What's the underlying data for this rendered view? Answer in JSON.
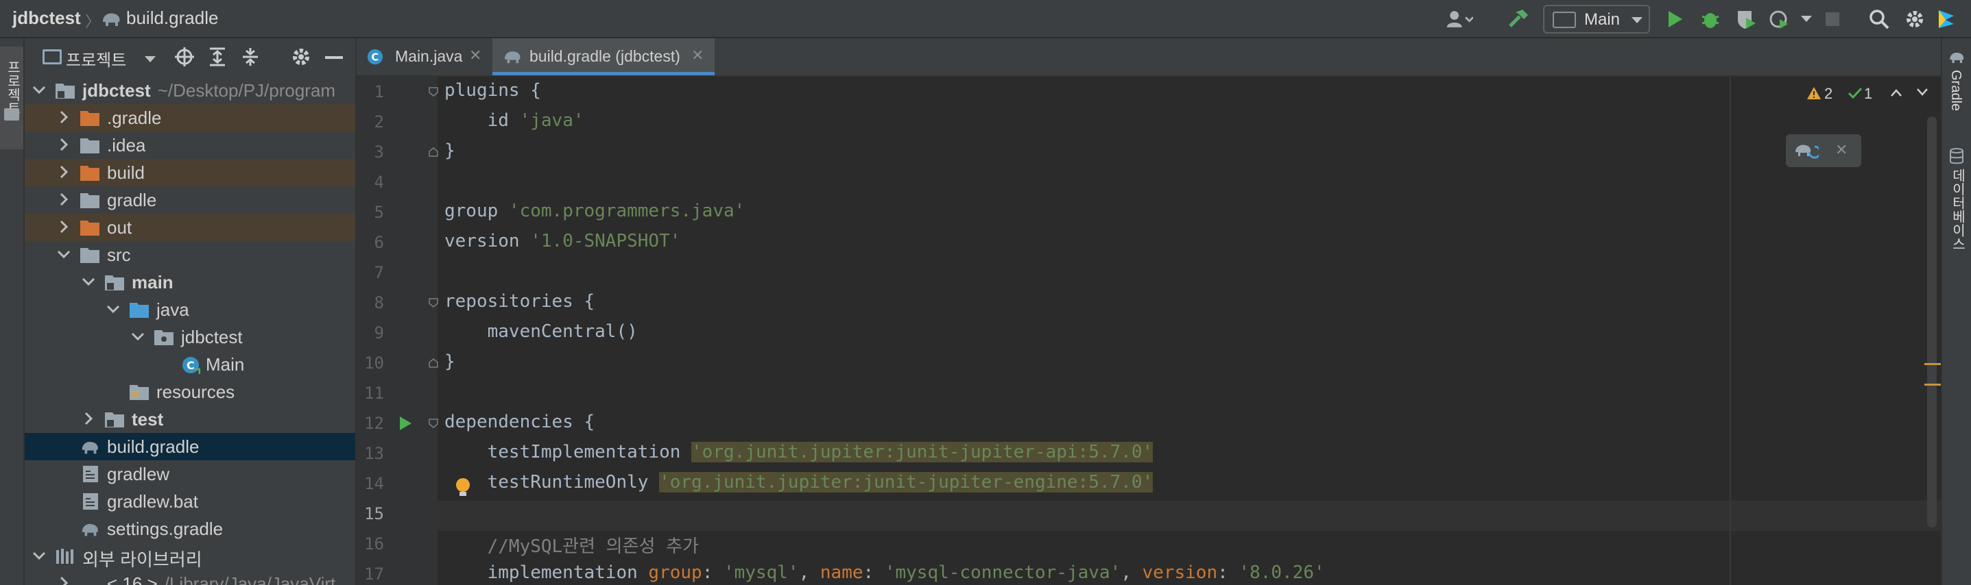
{
  "navbar": {
    "project": "jdbctest",
    "file": "build.gradle",
    "run_config": "Main"
  },
  "left_stripe": {
    "project_tab": "프로젝트"
  },
  "project_panel": {
    "title": "프로젝트",
    "tree": [
      {
        "label": "jdbctest",
        "hint": "~/Desktop/PJ/program",
        "bold": true
      },
      {
        "label": ".gradle"
      },
      {
        "label": ".idea"
      },
      {
        "label": "build"
      },
      {
        "label": "gradle"
      },
      {
        "label": "out"
      },
      {
        "label": "src"
      },
      {
        "label": "main",
        "bold": true
      },
      {
        "label": "java"
      },
      {
        "label": "jdbctest"
      },
      {
        "label": "Main"
      },
      {
        "label": "resources"
      },
      {
        "label": "test",
        "bold": true
      },
      {
        "label": "build.gradle"
      },
      {
        "label": "gradlew"
      },
      {
        "label": "gradlew.bat"
      },
      {
        "label": "settings.gradle"
      },
      {
        "label": "외부 라이브러리"
      },
      {
        "label": "< 16 >",
        "hint": "/Library/Java/JavaVirt"
      }
    ]
  },
  "tabs": [
    {
      "label": "Main.java"
    },
    {
      "label": "build.gradle (jdbctest)"
    }
  ],
  "editor": {
    "warnings": "2",
    "ok": "1",
    "line_numbers": [
      "1",
      "2",
      "3",
      "4",
      "5",
      "6",
      "7",
      "8",
      "9",
      "10",
      "11",
      "12",
      "13",
      "14",
      "15",
      "16",
      "17"
    ],
    "lines": {
      "l1": "plugins {",
      "l2a": "    id ",
      "l2b": "'java'",
      "l3": "}",
      "l5a": "group ",
      "l5b": "'com.programmers.java'",
      "l6a": "version ",
      "l6b": "'1.0-SNAPSHOT'",
      "l8": "repositories {",
      "l9": "    mavenCentral()",
      "l10": "}",
      "l12": "dependencies {",
      "l13a": "    testImplementation ",
      "l13b": "'org.junit.jupiter:junit-jupiter-api:5.7.0'",
      "l14a": "    testRuntimeOnly ",
      "l14b": "'org.junit.jupiter:junit-jupiter-engine:5.7.0'",
      "l16": "    //MySQL관련 의존성 추가",
      "l17a": "    implementation ",
      "l17b": "group",
      "l17c": ": ",
      "l17d": "'mysql'",
      "l17e": ", ",
      "l17f": "name",
      "l17g": ": ",
      "l17h": "'mysql-connector-java'",
      "l17i": ", ",
      "l17j": "version",
      "l17k": ": ",
      "l17l": "'8.0.26'"
    }
  },
  "right_stripe": {
    "gradle_tab": "Gradle",
    "database_tab": "데이터베이스"
  },
  "colors": {
    "accent": "#4a88c7",
    "excluded_bg": "#4a3f31",
    "selected_bg": "#0d293e"
  }
}
